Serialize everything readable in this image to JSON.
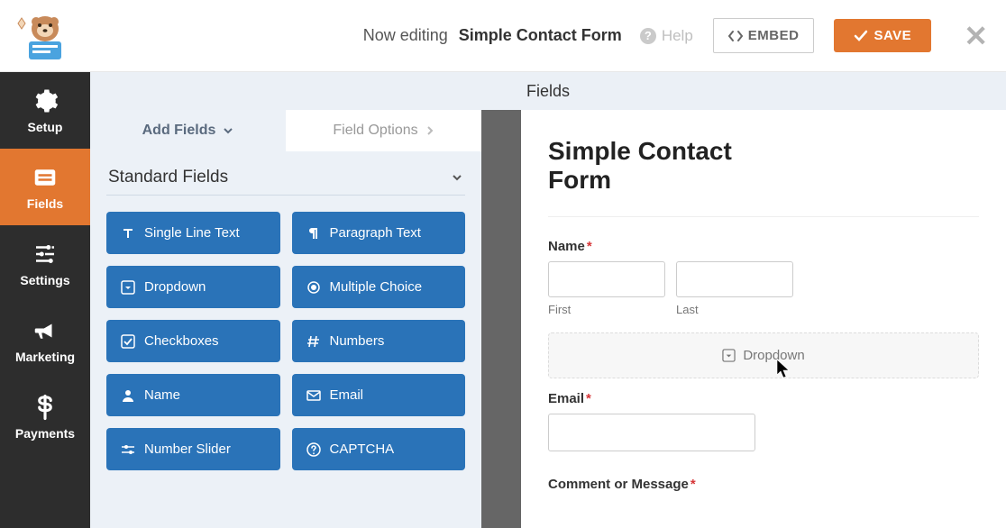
{
  "header": {
    "title_prefix": "Now editing",
    "title_name": "Simple Contact Form",
    "help_label": "Help",
    "embed_label": "EMBED",
    "save_label": "SAVE"
  },
  "sidebar": {
    "items": [
      {
        "label": "Setup"
      },
      {
        "label": "Fields"
      },
      {
        "label": "Settings"
      },
      {
        "label": "Marketing"
      },
      {
        "label": "Payments"
      }
    ]
  },
  "fields_header": "Fields",
  "panel": {
    "tabs": {
      "add": "Add Fields",
      "options": "Field Options"
    },
    "group_title": "Standard Fields",
    "fields": [
      "Single Line Text",
      "Paragraph Text",
      "Dropdown",
      "Multiple Choice",
      "Checkboxes",
      "Numbers",
      "Name",
      "Email",
      "Number Slider",
      "CAPTCHA"
    ]
  },
  "preview": {
    "title": "Simple Contact Form",
    "name_label": "Name",
    "first_label": "First",
    "last_label": "Last",
    "dropzone_label": "Dropdown",
    "email_label": "Email",
    "comment_label": "Comment or Message"
  }
}
